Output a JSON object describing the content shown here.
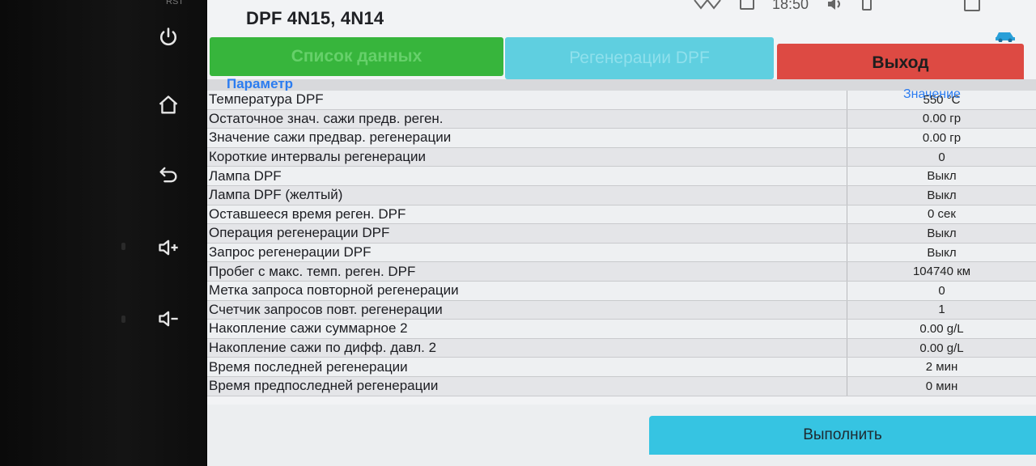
{
  "hardware": {
    "label": "RST",
    "buttons": [
      {
        "icon": "power-icon"
      },
      {
        "icon": "home-icon"
      },
      {
        "icon": "back-icon"
      },
      {
        "icon": "volume-up-icon"
      },
      {
        "icon": "volume-down-icon"
      }
    ]
  },
  "status": {
    "clock": "18:50"
  },
  "app": {
    "title": "DPF 4N15, 4N14",
    "tabs": {
      "data_list": "Список данных",
      "regeneration": "Регенерации DPF",
      "exit": "Выход"
    },
    "columns": {
      "param": "Параметр",
      "value": "Значение"
    },
    "rows": [
      {
        "name": "Температура DPF",
        "value": "550 °C"
      },
      {
        "name": "Остаточное знач. сажи предв. реген.",
        "value": "0.00 гр"
      },
      {
        "name": "Значение сажи предвар. регенерации",
        "value": "0.00 гр"
      },
      {
        "name": "Короткие интервалы регенерации",
        "value": "0"
      },
      {
        "name": "Лампа DPF",
        "value": "Выкл"
      },
      {
        "name": "Лампа DPF (желтый)",
        "value": "Выкл"
      },
      {
        "name": "Оставшееся время реген. DPF",
        "value": "0 сек"
      },
      {
        "name": "Операция регенерации DPF",
        "value": "Выкл"
      },
      {
        "name": "Запрос регенерации DPF",
        "value": "Выкл"
      },
      {
        "name": "Пробег с макс. темп. реген. DPF",
        "value": "104740 км"
      },
      {
        "name": "Метка запроса повторной регенерации",
        "value": "0"
      },
      {
        "name": "Счетчик запросов повт. регенерации",
        "value": "1"
      },
      {
        "name": "Накопление сажи суммарное 2",
        "value": "0.00 g/L"
      },
      {
        "name": "Накопление сажи по дифф. давл. 2",
        "value": "0.00 g/L"
      },
      {
        "name": "Время последней регенерации",
        "value": "2 мин"
      },
      {
        "name": "Время предпоследней регенерации",
        "value": "0 мин"
      }
    ],
    "run_button": "Выполнить"
  },
  "colors": {
    "green": "#37b53c",
    "cyan": "#5fcfe0",
    "red": "#dd4a43",
    "blue_header": "#2b7cf0"
  }
}
